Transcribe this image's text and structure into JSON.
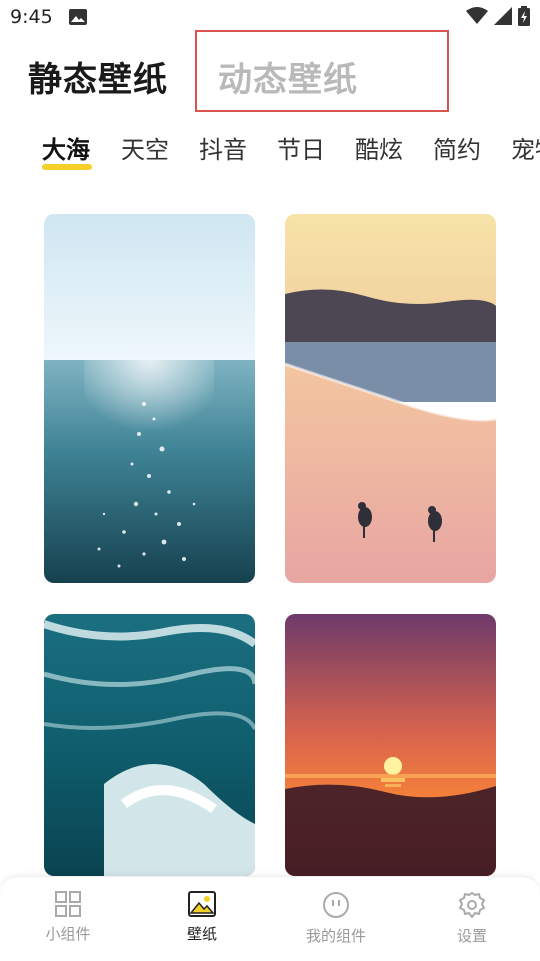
{
  "status_bar": {
    "time": "9:45",
    "icons": [
      "photo-icon",
      "wifi-icon",
      "signal-icon",
      "battery-charging-icon"
    ]
  },
  "header": {
    "tab_static": "静态壁纸",
    "tab_dynamic": "动态壁纸",
    "highlight_color": "#d9534f"
  },
  "categories": {
    "items": [
      "大海",
      "天空",
      "抖音",
      "节日",
      "酷炫",
      "简约",
      "宠物"
    ],
    "active_index": 0,
    "indicator_color": "#f5d02a"
  },
  "wallpapers": [
    {
      "subject": "sea-surface-sparkle"
    },
    {
      "subject": "beach-with-seagulls"
    },
    {
      "subject": "ocean-waves"
    },
    {
      "subject": "sunset-over-sea"
    }
  ],
  "bottom_nav": {
    "items": [
      {
        "label": "小组件",
        "icon": "widgets-icon"
      },
      {
        "label": "壁纸",
        "icon": "wallpaper-icon"
      },
      {
        "label": "我的组件",
        "icon": "my-widgets-icon"
      },
      {
        "label": "设置",
        "icon": "settings-icon"
      }
    ],
    "active_index": 1
  }
}
